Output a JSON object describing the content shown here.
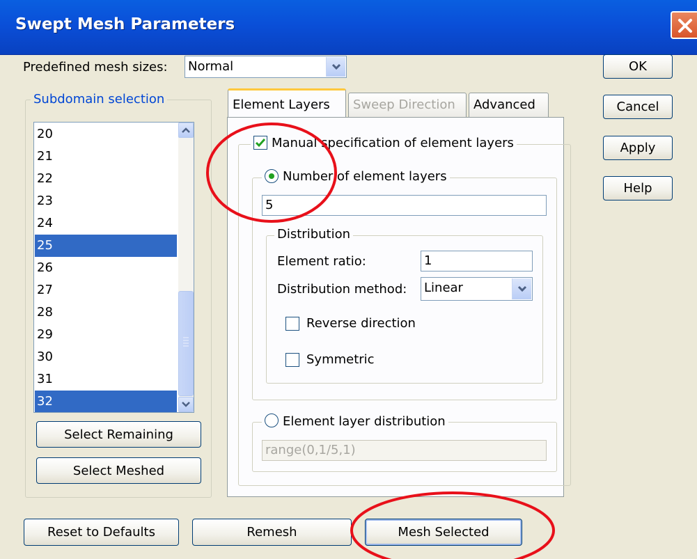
{
  "window": {
    "title": "Swept Mesh Parameters",
    "close_icon": "close-icon"
  },
  "mesh_sizes": {
    "label": "Predefined mesh sizes:",
    "value": "Normal"
  },
  "side_buttons": {
    "ok": "OK",
    "cancel": "Cancel",
    "apply": "Apply",
    "help": "Help"
  },
  "subdomain": {
    "title": "Subdomain selection",
    "items": [
      "20",
      "21",
      "22",
      "23",
      "24",
      "25",
      "26",
      "27",
      "28",
      "29",
      "30",
      "31",
      "32"
    ],
    "selected": [
      "25",
      "32"
    ],
    "select_remaining": "Select Remaining",
    "select_meshed": "Select Meshed"
  },
  "tabs": [
    {
      "label": "Element Layers",
      "state": "active"
    },
    {
      "label": "Sweep Direction",
      "state": "disabled"
    },
    {
      "label": "Advanced",
      "state": "normal"
    }
  ],
  "element_layers": {
    "manual_label": "Manual specification of element layers",
    "manual_checked": true,
    "number_label": "Number of element layers",
    "number_selected": true,
    "number_value": "5",
    "distribution_title": "Distribution",
    "ratio_label": "Element ratio:",
    "ratio_value": "1",
    "method_label": "Distribution method:",
    "method_value": "Linear",
    "reverse_label": "Reverse direction",
    "reverse_checked": false,
    "symmetric_label": "Symmetric",
    "symmetric_checked": false,
    "layer_dist_label": "Element layer distribution",
    "layer_dist_selected": false,
    "layer_dist_value": "range(0,1/5,1)"
  },
  "bottom_buttons": {
    "reset": "Reset to Defaults",
    "remesh": "Remesh",
    "mesh_selected": "Mesh Selected"
  },
  "annotation_color": "#e8101a"
}
